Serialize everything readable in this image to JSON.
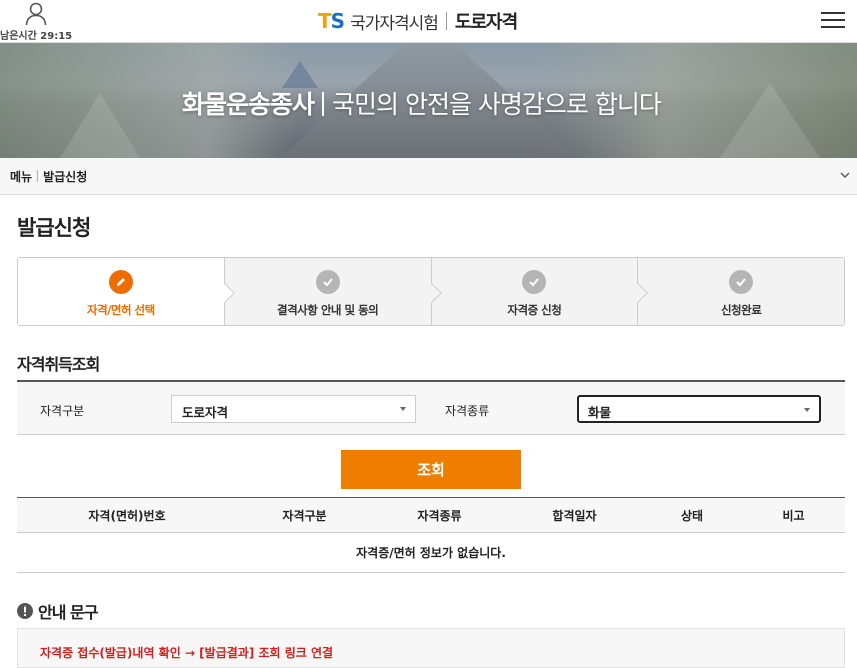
{
  "header": {
    "timer": "남은시간 29:15",
    "logo_t": "T",
    "logo_s": "S",
    "logo_org": "국가자격시험",
    "logo_sub": "도로자격"
  },
  "banner": {
    "title": "화물운송종사",
    "slogan": "국민의 안전을 사명감으로 합니다"
  },
  "breadcrumb": {
    "home": "메뉴",
    "current": "발급신청"
  },
  "page": {
    "title": "발급신청"
  },
  "steps": [
    {
      "label": "자격/면허 선택",
      "active": true
    },
    {
      "label": "결격사항 안내 및 동의",
      "active": false
    },
    {
      "label": "자격증 신청",
      "active": false
    },
    {
      "label": "신청완료",
      "active": false
    }
  ],
  "lookup": {
    "section_title": "자격취득조회",
    "field1_label": "자격구분",
    "field1_value": "도로자격",
    "field2_label": "자격종류",
    "field2_value": "화물",
    "search_label": "조회"
  },
  "results": {
    "columns": [
      "자격(면허)번호",
      "자격구분",
      "자격종류",
      "합격일자",
      "상태",
      "비고"
    ],
    "empty_message": "자격증/면허 정보가 없습니다."
  },
  "notice": {
    "title": "안내 문구",
    "line1": "자격증 접수(발급)내역 확인 → [발급결과] 조회 링크 연결"
  },
  "colors": {
    "accent": "#ef7d00",
    "active_step": "#ef6c00",
    "notice_text": "#d21f1f"
  }
}
